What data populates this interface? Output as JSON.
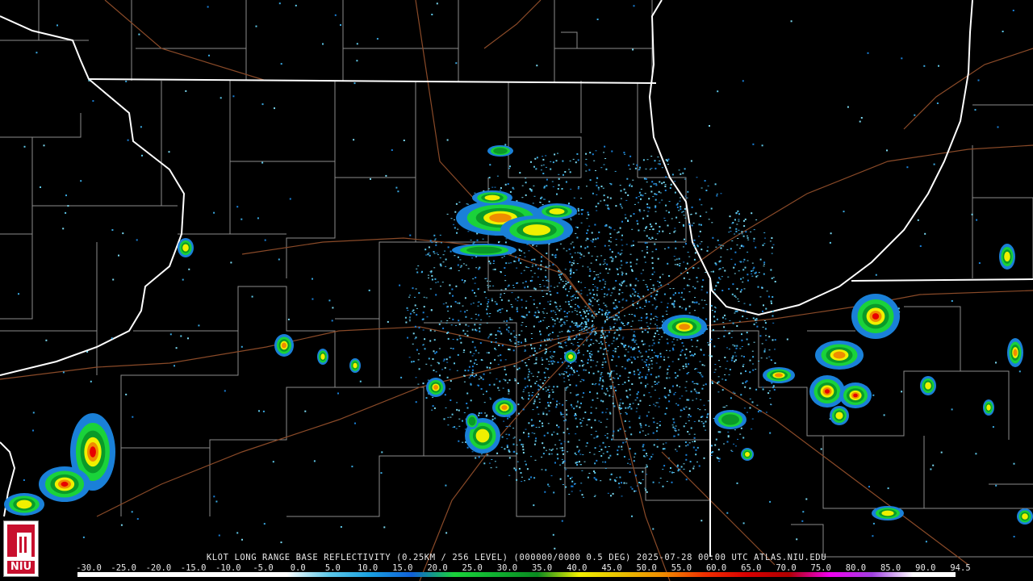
{
  "product": {
    "caption": "KLOT LONG RANGE BASE REFLECTIVITY (0.25KM / 256 LEVEL) (000000/0000 0.5 DEG) 2025-07-28 00:00 UTC  ATLAS.NIU.EDU",
    "logo_text": "NIU"
  },
  "scale": {
    "labels": [
      "-30.0",
      "-25.0",
      "-20.0",
      "-15.0",
      "-10.0",
      "-5.0",
      "0.0",
      "5.0",
      "10.0",
      "15.0",
      "20.0",
      "25.0",
      "30.0",
      "35.0",
      "40.0",
      "45.0",
      "50.0",
      "55.0",
      "60.0",
      "65.0",
      "70.0",
      "75.0",
      "80.0",
      "85.0",
      "90.0",
      "94.5"
    ],
    "colors": [
      "#ffffff",
      "#ffffff",
      "#ffffff",
      "#ffffff",
      "#ffffff",
      "#ffffff",
      "#5ec8e8",
      "#1aa0e0",
      "#1060d8",
      "#1ad23a",
      "#10b030",
      "#0a8a20",
      "#f0f000",
      "#e8c000",
      "#f08c00",
      "#f03000",
      "#d80000",
      "#b00000",
      "#f000f0",
      "#a040e0",
      "#ffffff",
      "#ffffff"
    ]
  },
  "colors": {
    "state_border": "#ffffff",
    "county_line": "#9a9a9a",
    "highway": "#8a4a28",
    "background": "#000000"
  }
}
